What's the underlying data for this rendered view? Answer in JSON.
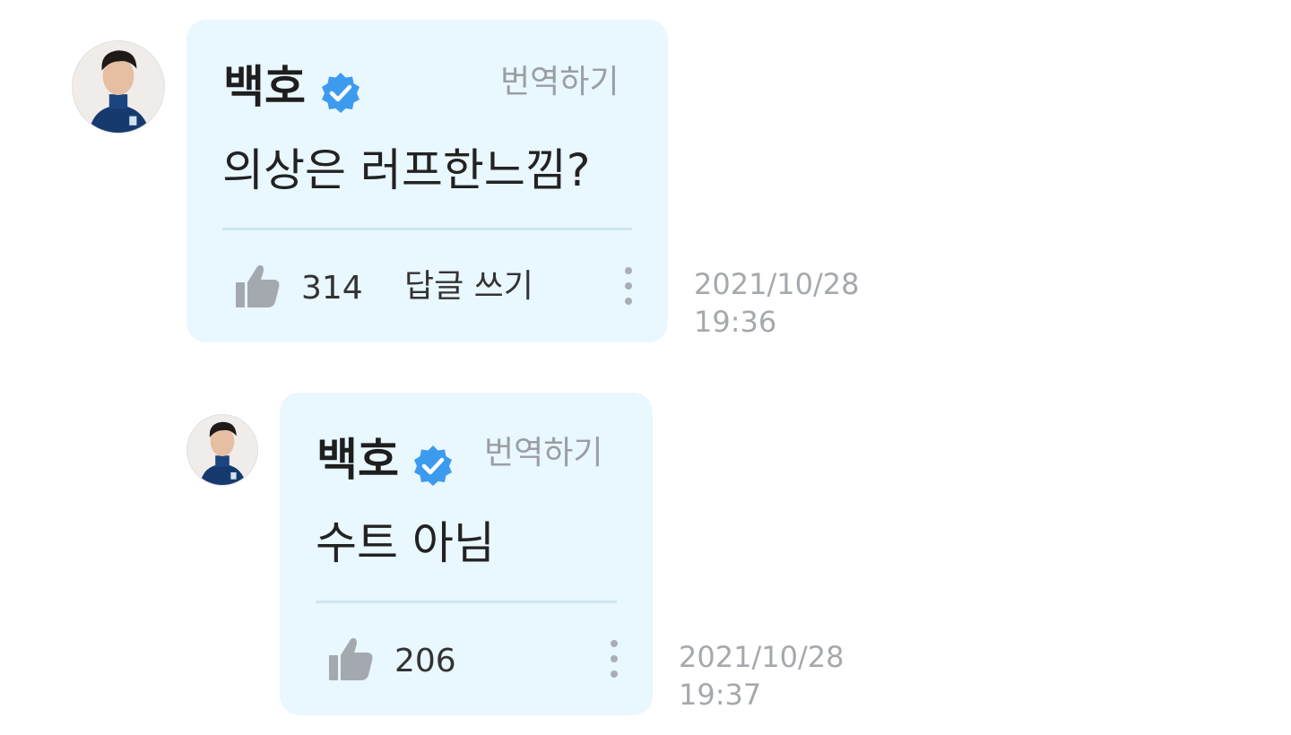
{
  "comments": [
    {
      "author": "백호",
      "verified_icon": "verified-badge-icon",
      "translate_label": "번역하기",
      "text": "의상은 러프한느낌?",
      "like_count": "314",
      "reply_label": "답글 쓰기",
      "date": "2021/10/28",
      "time": "19:36"
    },
    {
      "author": "백호",
      "verified_icon": "verified-badge-icon",
      "translate_label": "번역하기",
      "text": "수트 아님",
      "like_count": "206",
      "date": "2021/10/28",
      "time": "19:37"
    }
  ],
  "colors": {
    "bubble": "#e9f7fe",
    "badge": "#3d9bef",
    "muted_text": "#9a9ea4",
    "thumb_icon": "#a4a9af"
  }
}
